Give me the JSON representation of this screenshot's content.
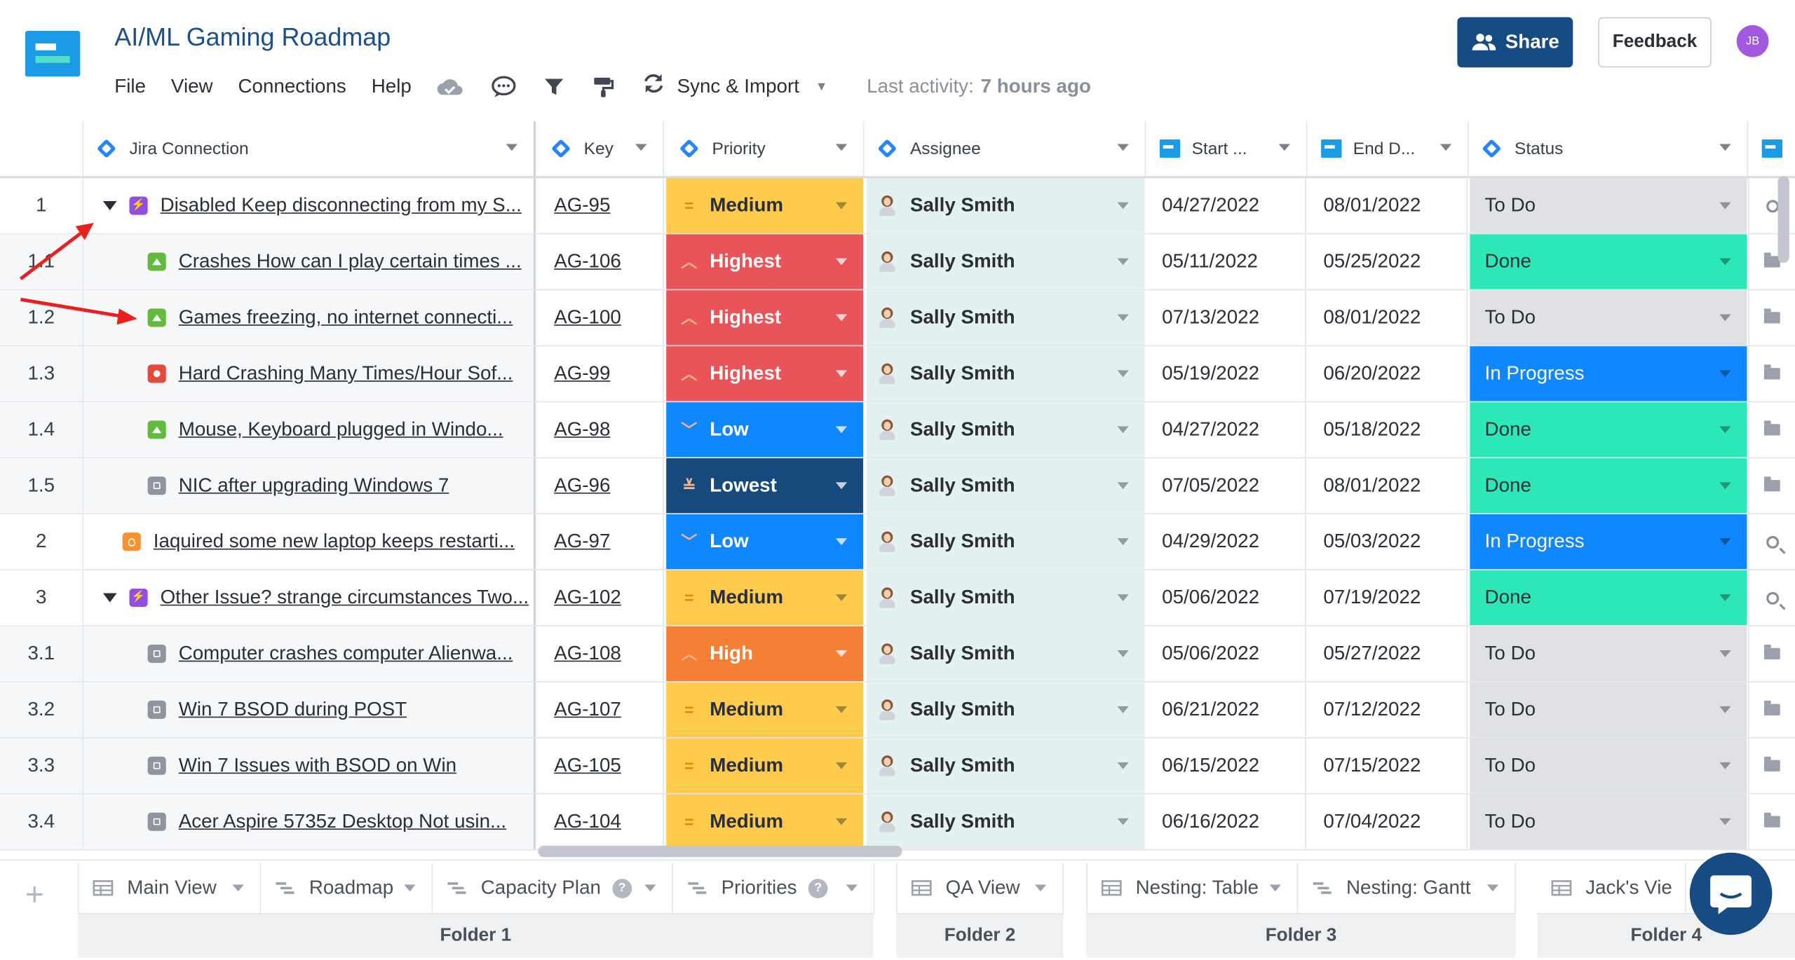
{
  "header": {
    "title": "AI/ML Gaming Roadmap",
    "menu": [
      "File",
      "View",
      "Connections",
      "Help"
    ],
    "sync_label": "Sync & Import",
    "activity_label": "Last activity:",
    "activity_value": "7 hours ago",
    "share_label": "Share",
    "feedback_label": "Feedback",
    "avatar_initials": "JB",
    "tool_icons": [
      "cloud-icon",
      "comment-icon",
      "filter-icon",
      "paint-format-icon",
      "sync-icon"
    ]
  },
  "columns": {
    "jira": "Jira Connection",
    "key": "Key",
    "priority": "Priority",
    "assignee": "Assignee",
    "start": "Start ...",
    "end": "End D...",
    "status": "Status"
  },
  "rows": [
    {
      "num": "1",
      "level": "parent",
      "expand": true,
      "type": "epic",
      "name": "Disabled Keep disconnecting from my S...",
      "key": "AG-95",
      "priority": "Medium",
      "assignee": "Sally Smith",
      "start": "04/27/2022",
      "end": "08/01/2022",
      "status": "To Do",
      "action": "search"
    },
    {
      "num": "1.1",
      "level": "child",
      "type": "story",
      "name": "Crashes How can I play certain times ...",
      "key": "AG-106",
      "priority": "Highest",
      "assignee": "Sally Smith",
      "start": "05/11/2022",
      "end": "05/25/2022",
      "status": "Done",
      "action": "folder"
    },
    {
      "num": "1.2",
      "level": "child",
      "type": "story",
      "name": "Games freezing, no internet connecti...",
      "key": "AG-100",
      "priority": "Highest",
      "assignee": "Sally Smith",
      "start": "07/13/2022",
      "end": "08/01/2022",
      "status": "To Do",
      "action": "folder"
    },
    {
      "num": "1.3",
      "level": "child",
      "type": "bug",
      "name": "Hard Crashing Many Times/Hour Sof...",
      "key": "AG-99",
      "priority": "Highest",
      "assignee": "Sally Smith",
      "start": "05/19/2022",
      "end": "06/20/2022",
      "status": "In Progress",
      "action": "folder"
    },
    {
      "num": "1.4",
      "level": "child",
      "type": "story",
      "name": "Mouse, Keyboard plugged in Windo...",
      "key": "AG-98",
      "priority": "Low",
      "assignee": "Sally Smith",
      "start": "04/27/2022",
      "end": "05/18/2022",
      "status": "Done",
      "action": "folder"
    },
    {
      "num": "1.5",
      "level": "child",
      "type": "task",
      "name": "NIC after upgrading Windows 7",
      "key": "AG-96",
      "priority": "Lowest",
      "assignee": "Sally Smith",
      "start": "07/05/2022",
      "end": "08/01/2022",
      "status": "Done",
      "action": "folder"
    },
    {
      "num": "2",
      "level": "parent",
      "expand": false,
      "type": "idea",
      "name": "Iaquired some new laptop keeps restarti...",
      "key": "AG-97",
      "priority": "Low",
      "assignee": "Sally Smith",
      "start": "04/29/2022",
      "end": "05/03/2022",
      "status": "In Progress",
      "action": "search"
    },
    {
      "num": "3",
      "level": "parent",
      "expand": true,
      "type": "epic",
      "name": "Other Issue? strange circumstances Two...",
      "key": "AG-102",
      "priority": "Medium",
      "assignee": "Sally Smith",
      "start": "05/06/2022",
      "end": "07/19/2022",
      "status": "Done",
      "action": "search"
    },
    {
      "num": "3.1",
      "level": "child",
      "type": "task",
      "name": "Computer crashes computer Alienwa...",
      "key": "AG-108",
      "priority": "High",
      "assignee": "Sally Smith",
      "start": "05/06/2022",
      "end": "05/27/2022",
      "status": "To Do",
      "action": "folder"
    },
    {
      "num": "3.2",
      "level": "child",
      "type": "task",
      "name": "Win 7 BSOD during POST",
      "key": "AG-107",
      "priority": "Medium",
      "assignee": "Sally Smith",
      "start": "06/21/2022",
      "end": "07/12/2022",
      "status": "To Do",
      "action": "folder"
    },
    {
      "num": "3.3",
      "level": "child",
      "type": "task",
      "name": "Win 7 Issues with BSOD on Win",
      "key": "AG-105",
      "priority": "Medium",
      "assignee": "Sally Smith",
      "start": "06/15/2022",
      "end": "07/15/2022",
      "status": "To Do",
      "action": "folder"
    },
    {
      "num": "3.4",
      "level": "child",
      "type": "task",
      "name": "Acer Aspire 5735z Desktop Not usin...",
      "key": "AG-104",
      "priority": "Medium",
      "assignee": "Sally Smith",
      "start": "06/16/2022",
      "end": "07/04/2022",
      "status": "To Do",
      "action": "folder"
    }
  ],
  "priority_colors": {
    "Medium": "#fecb4d",
    "Highest": "#e9545a",
    "High": "#f57f34",
    "Low": "#0f87ff",
    "Lowest": "#174a7c"
  },
  "status_colors": {
    "To Do": "#dfe1e5",
    "Done": "#2ce8b8",
    "In Progress": "#0f87ff"
  },
  "views": [
    {
      "label": "Main View",
      "icon": "table-icon"
    },
    {
      "label": "Roadmap",
      "icon": "gantt-icon"
    },
    {
      "label": "Capacity Plan",
      "icon": "gantt-icon",
      "help": "?"
    },
    {
      "label": "Priorities",
      "icon": "gantt-icon",
      "help": "?"
    },
    {
      "label": "QA View",
      "icon": "table-icon"
    },
    {
      "label": "Nesting: Table",
      "icon": "table-icon"
    },
    {
      "label": "Nesting: Gantt",
      "icon": "gantt-icon"
    },
    {
      "label": "Jack's Vie",
      "icon": "table-icon"
    }
  ],
  "folders": [
    "Folder 1",
    "Folder 2",
    "Folder 3",
    "Folder 4"
  ],
  "add_view_symbol": "+"
}
